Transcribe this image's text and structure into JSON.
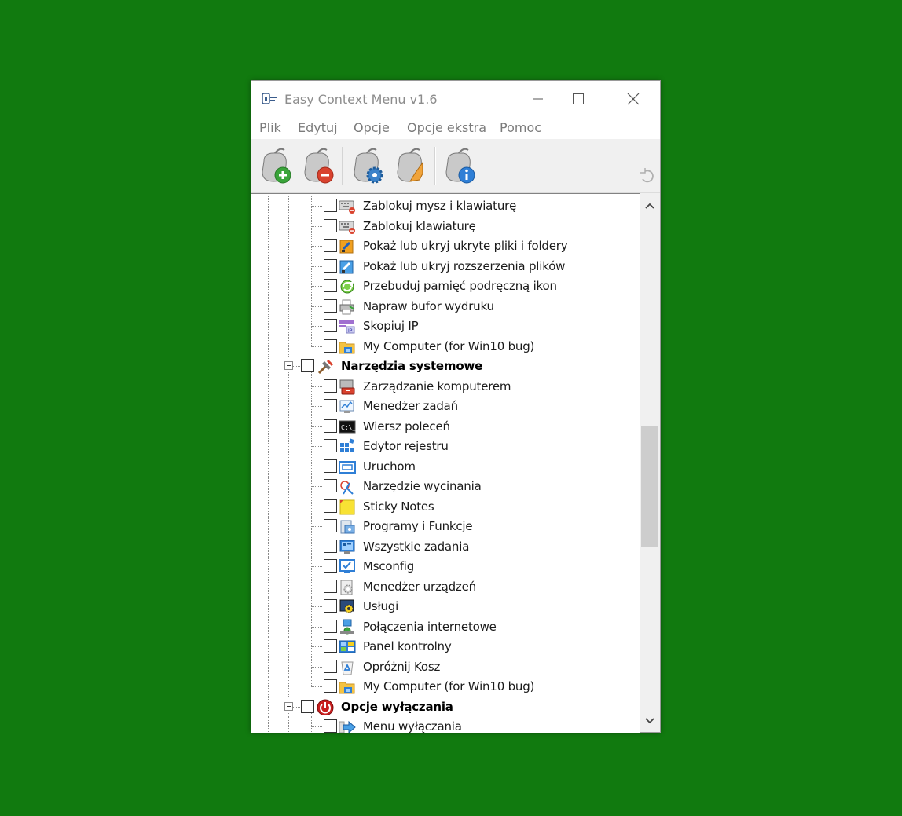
{
  "window": {
    "title": "Easy Context Menu v1.6",
    "controls": {
      "minimize": "minimize",
      "maximize": "maximize",
      "close": "close"
    }
  },
  "menu": [
    "Plik",
    "Edytuj",
    "Opcje",
    "Opcje ekstra",
    "Pomoc"
  ],
  "toolbar": {
    "buttons": [
      {
        "icon": "mouse-add-icon"
      },
      {
        "icon": "mouse-remove-icon"
      },
      {
        "icon": "mouse-settings-icon"
      },
      {
        "icon": "mouse-clean-icon"
      },
      {
        "icon": "mouse-info-icon"
      }
    ],
    "undo_icon": "undo-icon"
  },
  "tree": {
    "items": [
      {
        "level": 3,
        "label": "Zablokuj mysz i klawiaturę",
        "icon": "keyboard-lock-icon"
      },
      {
        "level": 3,
        "label": "Zablokuj klawiaturę",
        "icon": "keyboard-lock-icon"
      },
      {
        "level": 3,
        "label": "Pokaż lub ukryj ukryte pliki i foldery",
        "icon": "hidden-files-icon"
      },
      {
        "level": 3,
        "label": "Pokaż lub ukryj rozszerzenia plików",
        "icon": "file-extensions-icon"
      },
      {
        "level": 3,
        "label": "Przebuduj pamięć podręczną ikon",
        "icon": "refresh-icon"
      },
      {
        "level": 3,
        "label": "Napraw bufor wydruku",
        "icon": "printer-icon"
      },
      {
        "level": 3,
        "label": "Skopiuj IP",
        "icon": "ip-icon"
      },
      {
        "level": 3,
        "label": "My Computer (for Win10 bug)",
        "icon": "folder-icon",
        "last": true
      },
      {
        "level": 2,
        "label": "Narzędzia systemowe",
        "icon": "tools-icon",
        "bold": true,
        "expanded": true
      },
      {
        "level": 3,
        "label": "Zarządzanie komputerem",
        "icon": "computer-management-icon"
      },
      {
        "level": 3,
        "label": "Menedżer zadań",
        "icon": "task-manager-icon"
      },
      {
        "level": 3,
        "label": "Wiersz poleceń",
        "icon": "command-prompt-icon"
      },
      {
        "level": 3,
        "label": "Edytor rejestru",
        "icon": "registry-icon"
      },
      {
        "level": 3,
        "label": "Uruchom",
        "icon": "run-icon"
      },
      {
        "level": 3,
        "label": "Narzędzie wycinania",
        "icon": "snipping-tool-icon"
      },
      {
        "level": 3,
        "label": "Sticky Notes",
        "icon": "sticky-notes-icon"
      },
      {
        "level": 3,
        "label": "Programy i Funkcje",
        "icon": "programs-icon"
      },
      {
        "level": 3,
        "label": "Wszystkie zadania",
        "icon": "all-tasks-icon"
      },
      {
        "level": 3,
        "label": "Msconfig",
        "icon": "msconfig-icon"
      },
      {
        "level": 3,
        "label": "Menedżer urządzeń",
        "icon": "device-manager-icon"
      },
      {
        "level": 3,
        "label": "Usługi",
        "icon": "services-icon"
      },
      {
        "level": 3,
        "label": "Połączenia internetowe",
        "icon": "network-icon"
      },
      {
        "level": 3,
        "label": "Panel kontrolny",
        "icon": "control-panel-icon"
      },
      {
        "level": 3,
        "label": "Opróżnij Kosz",
        "icon": "recycle-bin-icon"
      },
      {
        "level": 3,
        "label": "My Computer (for Win10 bug)",
        "icon": "folder-icon",
        "last": true
      },
      {
        "level": 2,
        "label": "Opcje wyłączania",
        "icon": "power-icon",
        "bold": true,
        "expanded": true
      },
      {
        "level": 3,
        "label": "Menu wyłączania",
        "icon": "arrow-right-icon"
      }
    ]
  },
  "scrollbar": {
    "position": 0.43
  }
}
